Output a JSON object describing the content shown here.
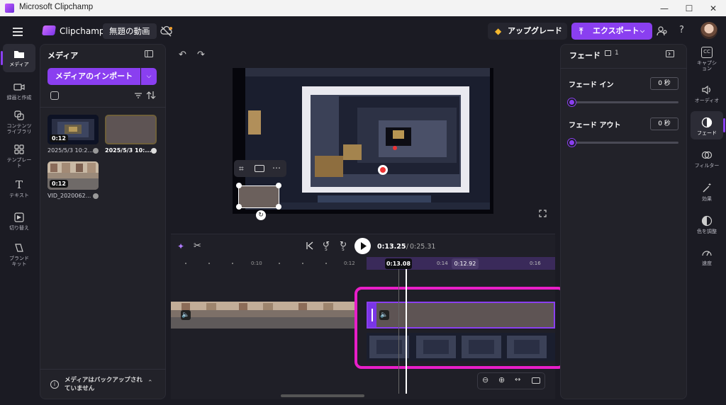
{
  "window": {
    "title": "Microsoft Clipchamp",
    "minimize": "—",
    "maximize": "☐",
    "close": "✕"
  },
  "appbar": {
    "brand": "Clipchamp",
    "project_name": "無題の動画",
    "upgrade_label": "アップグレード",
    "export_label": "エクスポート"
  },
  "left_rail": [
    {
      "label": "メディア",
      "icon": "folder-icon"
    },
    {
      "label": "録画と作成",
      "icon": "camera-icon"
    },
    {
      "label": "コンテンツライブラリ",
      "icon": "library-icon"
    },
    {
      "label": "テンプレート",
      "icon": "grid-icon"
    },
    {
      "label": "テキスト",
      "icon": "text-icon"
    },
    {
      "label": "切り替え",
      "icon": "transition-icon"
    },
    {
      "label": "ブランドキット",
      "icon": "brand-icon"
    }
  ],
  "media": {
    "title": "メディア",
    "import_label": "メディアのインポート",
    "items": [
      {
        "duration": "0:12",
        "caption": "2025/5/3 10:2..."
      },
      {
        "duration": "",
        "caption": "2025/5/3 10:..."
      },
      {
        "duration": "0:12",
        "caption": "VID_2020062..."
      }
    ],
    "backup_notice": "メディアはバックアップされていません"
  },
  "playback": {
    "current": "0:13.25",
    "separator": " / ",
    "total": "0:25.31",
    "skip_back": "5",
    "skip_fwd": "5"
  },
  "ruler": {
    "ticks": [
      "0:10",
      "0:12",
      "0:14",
      "0:16"
    ],
    "playhead": "0:13.08",
    "hover": "0:12.92"
  },
  "fade_panel": {
    "title": "フェード",
    "clip_count": "1",
    "fade_in_label": "フェード イン",
    "fade_in_value": "0",
    "fade_out_label": "フェード アウト",
    "fade_out_value": "0",
    "unit": "秒"
  },
  "right_rail": [
    {
      "label": "キャプション",
      "icon": "cc-icon"
    },
    {
      "label": "オーディオ",
      "icon": "speaker-icon"
    },
    {
      "label": "フェード",
      "icon": "fade-icon"
    },
    {
      "label": "フィルター",
      "icon": "filter-icon"
    },
    {
      "label": "効果",
      "icon": "wand-icon"
    },
    {
      "label": "色を調整",
      "icon": "contrast-icon"
    },
    {
      "label": "速度",
      "icon": "speed-icon"
    }
  ],
  "colors": {
    "accent": "#8a3ff0",
    "highlight": "#e81ec8",
    "background": "#1b1b23",
    "panel": "#222229"
  }
}
